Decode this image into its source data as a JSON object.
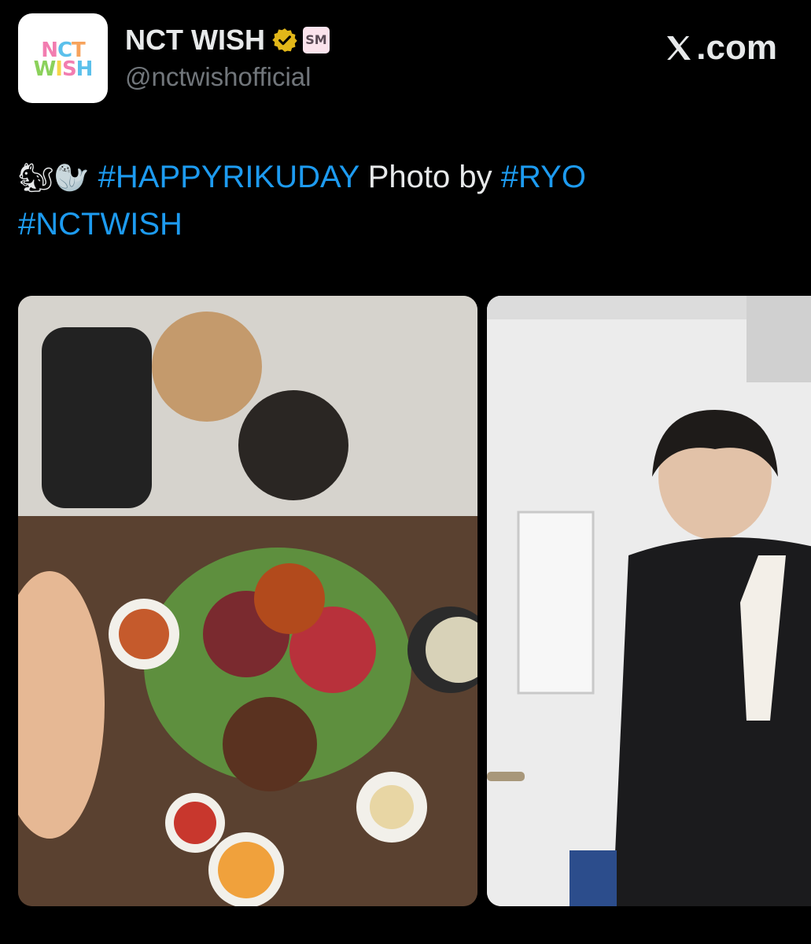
{
  "account": {
    "logo_line1": [
      "N",
      "C",
      "T"
    ],
    "logo_line2": [
      "W",
      "I",
      "S",
      "H"
    ],
    "logo_colors_line1": [
      "#f27db0",
      "#5bc0eb",
      "#f7a35c"
    ],
    "logo_colors_line2": [
      "#8bd15b",
      "#f7d54a",
      "#f27db0",
      "#5bc0eb"
    ],
    "display_name": "NCT WISH",
    "handle": "@nctwishofficial",
    "verified_badge": "gold-verified-icon",
    "agency_badge": "SM"
  },
  "site": {
    "label": ".com",
    "logo": "x-logo-icon"
  },
  "tweet": {
    "emoji_1": "🐿",
    "emoji_2": "🦭",
    "hashtag_1": "#HAPPYRIKUDAY",
    "text_1": " Photo by ",
    "hashtag_2": "#RYO",
    "hashtag_3": "#NCTWISH"
  },
  "colors": {
    "background": "#000000",
    "text": "#e7e9ea",
    "secondary_text": "#71767b",
    "link": "#1d9bf0",
    "verified_gold": "#e2b719"
  }
}
